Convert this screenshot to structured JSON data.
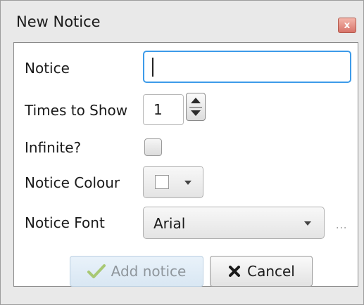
{
  "window": {
    "title": "New Notice",
    "close_glyph": "x"
  },
  "form": {
    "notice_label": "Notice",
    "notice_value": "",
    "times_label": "Times to Show",
    "times_value": "1",
    "infinite_label": "Infinite?",
    "infinite_checked": false,
    "colour_label": "Notice Colour",
    "colour_value": "#ffffff",
    "font_label": "Notice Font",
    "font_value": "Arial",
    "more_label": "..."
  },
  "buttons": {
    "add_label": "Add notice",
    "add_enabled": false,
    "cancel_label": "Cancel"
  },
  "icons": {
    "add": "checkmark-icon",
    "cancel": "x-icon"
  }
}
